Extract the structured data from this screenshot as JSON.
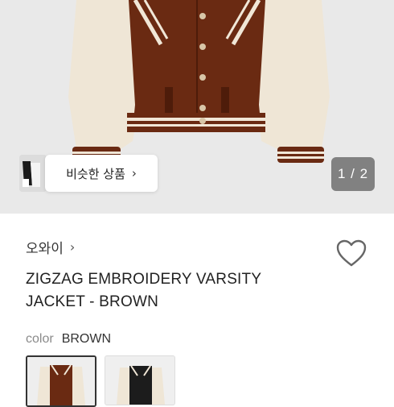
{
  "product": {
    "brand": "오와이",
    "title_line1": "ZIGZAG EMBROIDERY VARSITY",
    "title_line2": "JACKET - BROWN"
  },
  "gallery": {
    "similar_label": "비슷한 상품",
    "page_indicator": "1 / 2"
  },
  "options": {
    "color_label": "color",
    "color_value": "BROWN"
  },
  "icons": {
    "brand_chevron": "chevron-right-icon",
    "similar_chevron": "chevron-right-icon",
    "wishlist": "heart-icon"
  },
  "colors": {
    "jacket_body": "#6a2a12",
    "sleeve": "#efe6d6",
    "stripe": "#f1e7d7",
    "indicator_bg": "#6e6e6e"
  }
}
